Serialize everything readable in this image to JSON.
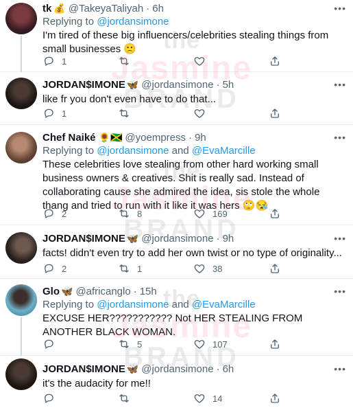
{
  "tweets": [
    {
      "name": "tk",
      "name_emoji": "💰",
      "handle": "@TakeyaTaliyah",
      "time": "6h",
      "reply_to_prefix": "Replying to",
      "reply_to": [
        "@jordansimone"
      ],
      "text": "I'm tired of these big influencers/celebrities stealing things from small businesses 🙁",
      "replies": "1",
      "retweets": "",
      "likes": ""
    },
    {
      "name": "JORDAN$IMONE",
      "name_emoji": "🦋",
      "handle": "@jordansimone",
      "time": "5h",
      "reply_to_prefix": "",
      "reply_to": [],
      "text": "like fr you don't even have to do that...",
      "replies": "1",
      "retweets": "",
      "likes": ""
    },
    {
      "name": "Chef Naiké",
      "name_emoji": "🌻🇯🇲",
      "handle": "@yoempress",
      "time": "9h",
      "reply_to_prefix": "Replying to",
      "reply_to": [
        "@jordansimone",
        "@EvaMarcille"
      ],
      "reply_join": "and",
      "text": "These celebrities love stealing from other hard working small business owners & creatives. Shit is really sad. Instead of collaborating cause she admired the idea, sis stole the whole thang and tried to run with it like it was hers 🙄😪",
      "replies": "2",
      "retweets": "8",
      "likes": "169"
    },
    {
      "name": "JORDAN$IMONE",
      "name_emoji": "🦋",
      "handle": "@jordansimone",
      "time": "9h",
      "reply_to_prefix": "",
      "reply_to": [],
      "text": "facts! didn't even try to add her own twist or no type of originality...",
      "replies": "2",
      "retweets": "1",
      "likes": "38"
    },
    {
      "name": "Glo",
      "name_emoji": "🦋",
      "handle": "@africanglo",
      "time": "15h",
      "reply_to_prefix": "Replying to",
      "reply_to": [
        "@jordansimone",
        "@EvaMarcille"
      ],
      "reply_join": "and",
      "text": "EXCUSE HER??????????? Not HER STEALING FROM ANOTHER BLACK WOMAN.",
      "replies": "",
      "retweets": "5",
      "likes": "107"
    },
    {
      "name": "JORDAN$IMONE",
      "name_emoji": "🦋",
      "handle": "@jordansimone",
      "time": "6h",
      "reply_to_prefix": "",
      "reply_to": [],
      "text": "it's the audacity for me!!",
      "replies": "",
      "retweets": "",
      "likes": "14"
    }
  ],
  "separator_dot": "·",
  "more_glyph": "•••",
  "watermark": {
    "line1": "the",
    "line2": "Jasmine",
    "line3": "BRAND"
  },
  "colors": {
    "link": "#1d9bf0",
    "muted": "#536471",
    "text": "#0f1419",
    "border": "#e6ecf0"
  },
  "icons": [
    "reply-icon",
    "retweet-icon",
    "like-icon",
    "share-icon",
    "more-icon"
  ]
}
